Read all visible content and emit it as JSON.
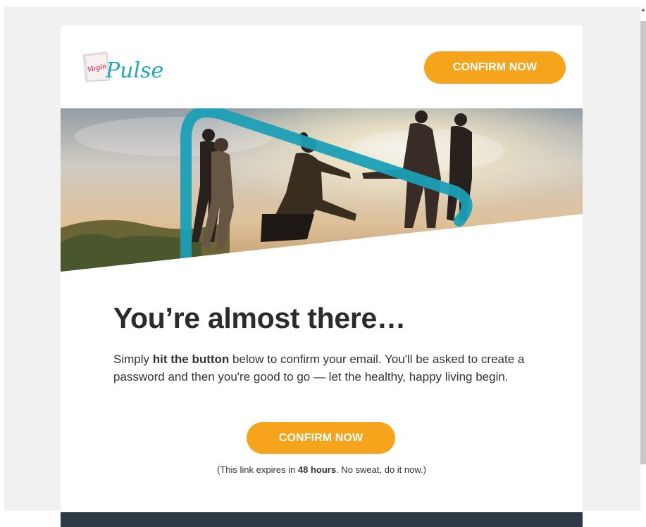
{
  "brand": {
    "name": "Virgin Pulse",
    "virgin": "Virgin",
    "pulse": "Pulse",
    "accent": "#f7a41d",
    "teal": "#1ea7bf",
    "dark": "#2e3946"
  },
  "header": {
    "confirm_label": "CONFIRM NOW"
  },
  "hero": {
    "image_icon": "people-helping-sunset-photo"
  },
  "main": {
    "headline": "You’re almost there…",
    "body_pre": "Simply ",
    "body_bold": "hit the button",
    "body_post": " below to confirm your email. You'll be asked to create a password and then you're good to go — let the healthy, happy living begin.",
    "confirm_label": "CONFIRM NOW",
    "note_pre": "(This link expires in ",
    "note_bold": "48 hours",
    "note_post": ". No sweat, do it now.)"
  }
}
